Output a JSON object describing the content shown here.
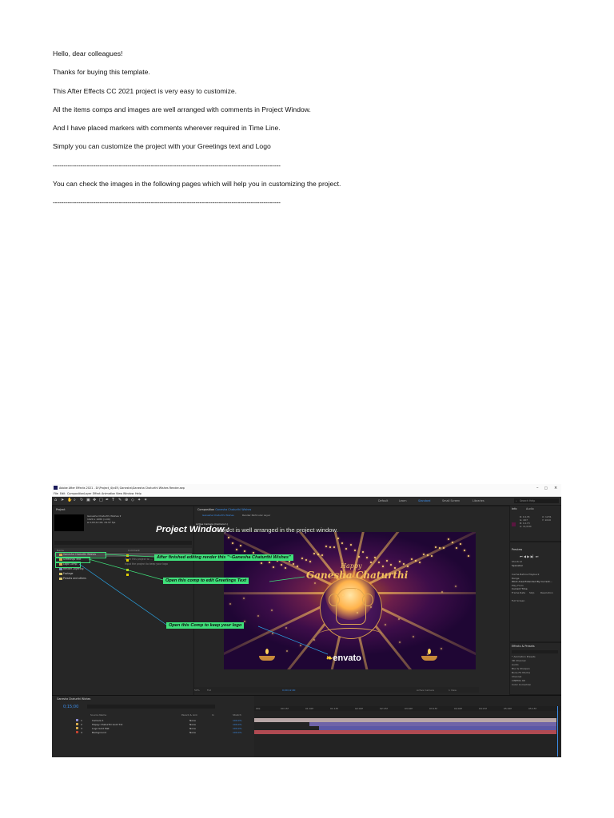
{
  "document": {
    "lines": [
      "Hello, dear colleagues!",
      "Thanks for buying this template.",
      "This After Effects CC 2021 project is very easy to customize.",
      "All the items comps and images are well arranged with comments in Project Window.",
      "And I have placed markers with comments wherever required in Time Line.",
      "Simply you can customize the project with your Greetings text and Logo",
      "-----------------------------------------------------------------------------------------------------------",
      "You can check the images in the following pages which will help you in customizing the project.",
      "-----------------------------------------------------------------------------------------------------------"
    ]
  },
  "app": {
    "title": "Adobe After Effects 2021 - D:\\Project_4\\v45\\ Ganesha\\Ganesha Chaturthi Wishes Render.aep",
    "window_controls": [
      "–",
      "□",
      "×"
    ],
    "menu": [
      "File",
      "Edit",
      "Composition",
      "Layer",
      "Effect",
      "Animation",
      "View",
      "Window",
      "Help"
    ],
    "workspaces": [
      "Default",
      "Learn",
      "Standard",
      "Small Screen",
      "Libraries"
    ],
    "active_workspace": "Standard",
    "search_help": "Search Help"
  },
  "project_panel": {
    "tab": "Project",
    "selected_info": [
      "Ganesha Chaturthi Wishes ▾",
      "1920 x 1080 (1.00)",
      "Δ 0;00;12;00, 29.97 fps"
    ],
    "columns": [
      "Name",
      "Comment"
    ],
    "items": [
      {
        "name": "Ganesha Chaturthi Wishes",
        "comment": ""
      },
      {
        "name": "Greetings Text",
        "comment": "Open this project to ..."
      },
      {
        "name": "Logo Comp",
        "comment": "Input the project to keep your logo"
      },
      {
        "name": "Render Layering",
        "comment": ""
      },
      {
        "name": "Footage",
        "comment": ""
      },
      {
        "name": "Presets and others",
        "comment": ""
      }
    ]
  },
  "composition": {
    "tab": "Composition",
    "comp_name": "Ganesha Chaturthi Wishes",
    "subtabs": [
      "Ganesha Chaturthi Wishes",
      "Render Particular Layer"
    ],
    "active_camera": "Active Camera (Camera 1)",
    "happy": "Happy",
    "title": "Ganesha Chaturthi",
    "logo": "envato",
    "zoom": "50%",
    "quality": "Full",
    "timecode": "0;00;12;00",
    "view": "Active Camera",
    "views": "1 View"
  },
  "annotations": {
    "project_window_label": "Project Window :",
    "project_window_desc": "Project is well arranged in the project window.",
    "callout_render": "After finished editing render this \"~Ganesha Chaturthi Wishes\"",
    "callout_greetings": "Open this comp to edit Greetings Text",
    "callout_logo": "Open this Comp to keep your logo"
  },
  "right_panels": {
    "info_tab": "Info",
    "audio_tab": "Audio",
    "info_values": [
      "R: 0.174",
      "G: 407",
      "B: 0.173",
      "A: 11/100"
    ],
    "info_xy": [
      "X: 1231",
      "Y: 1010"
    ],
    "preview_tab": "Preview",
    "shortcut_label": "Shortcut",
    "shortcut_value": "Spacebar",
    "cache_label": "Cache Before Playback",
    "range_label": "Range",
    "range_value": "Work Area Extended By Current...",
    "play_from_label": "Play From",
    "play_from_value": "Current Time",
    "frame_rate": "Frame Rate",
    "skip": "Skip",
    "resolution": "Resolution",
    "full_screen": "Full Screen",
    "effects_tab": "Effects & Presets",
    "effects_items": [
      "* Animation Presets",
      "3D Channel",
      "Audio",
      "Blur & Sharpen",
      "Boris FX Mocha",
      "Channel",
      "CINEMA 4D",
      "Color Correction"
    ]
  },
  "timeline": {
    "tab": "Ganesha Chaturthi Wishes",
    "timecode": "0;15;00",
    "ruler": [
      "00s",
      "00:15f",
      "01:00f",
      "01:15f",
      "02:00f",
      "02:15f",
      "03:00f",
      "03:15f",
      "04:00f",
      "04:15f",
      "05:00f",
      "05:15f"
    ],
    "col_headers": [
      "Source Name",
      "Parent & Link",
      "In",
      "Stretch"
    ],
    "layers": [
      {
        "num": "1",
        "name": "Camera 1",
        "color": "#8a8ad0",
        "bar_color": "#b8a6a6"
      },
      {
        "num": "2",
        "name": "Happy Chaturthi Gold Txt",
        "color": "#d3a84b",
        "bar_color": "#6f64a8"
      },
      {
        "num": "3",
        "name": "Logo Gold Mat",
        "color": "#d3a84b",
        "bar_color": "#5c58a6"
      },
      {
        "num": "4",
        "name": "Background",
        "color": "#c0402f",
        "bar_color": "#b04a52"
      }
    ],
    "parent_value": "None",
    "in_value": "100.0%"
  }
}
